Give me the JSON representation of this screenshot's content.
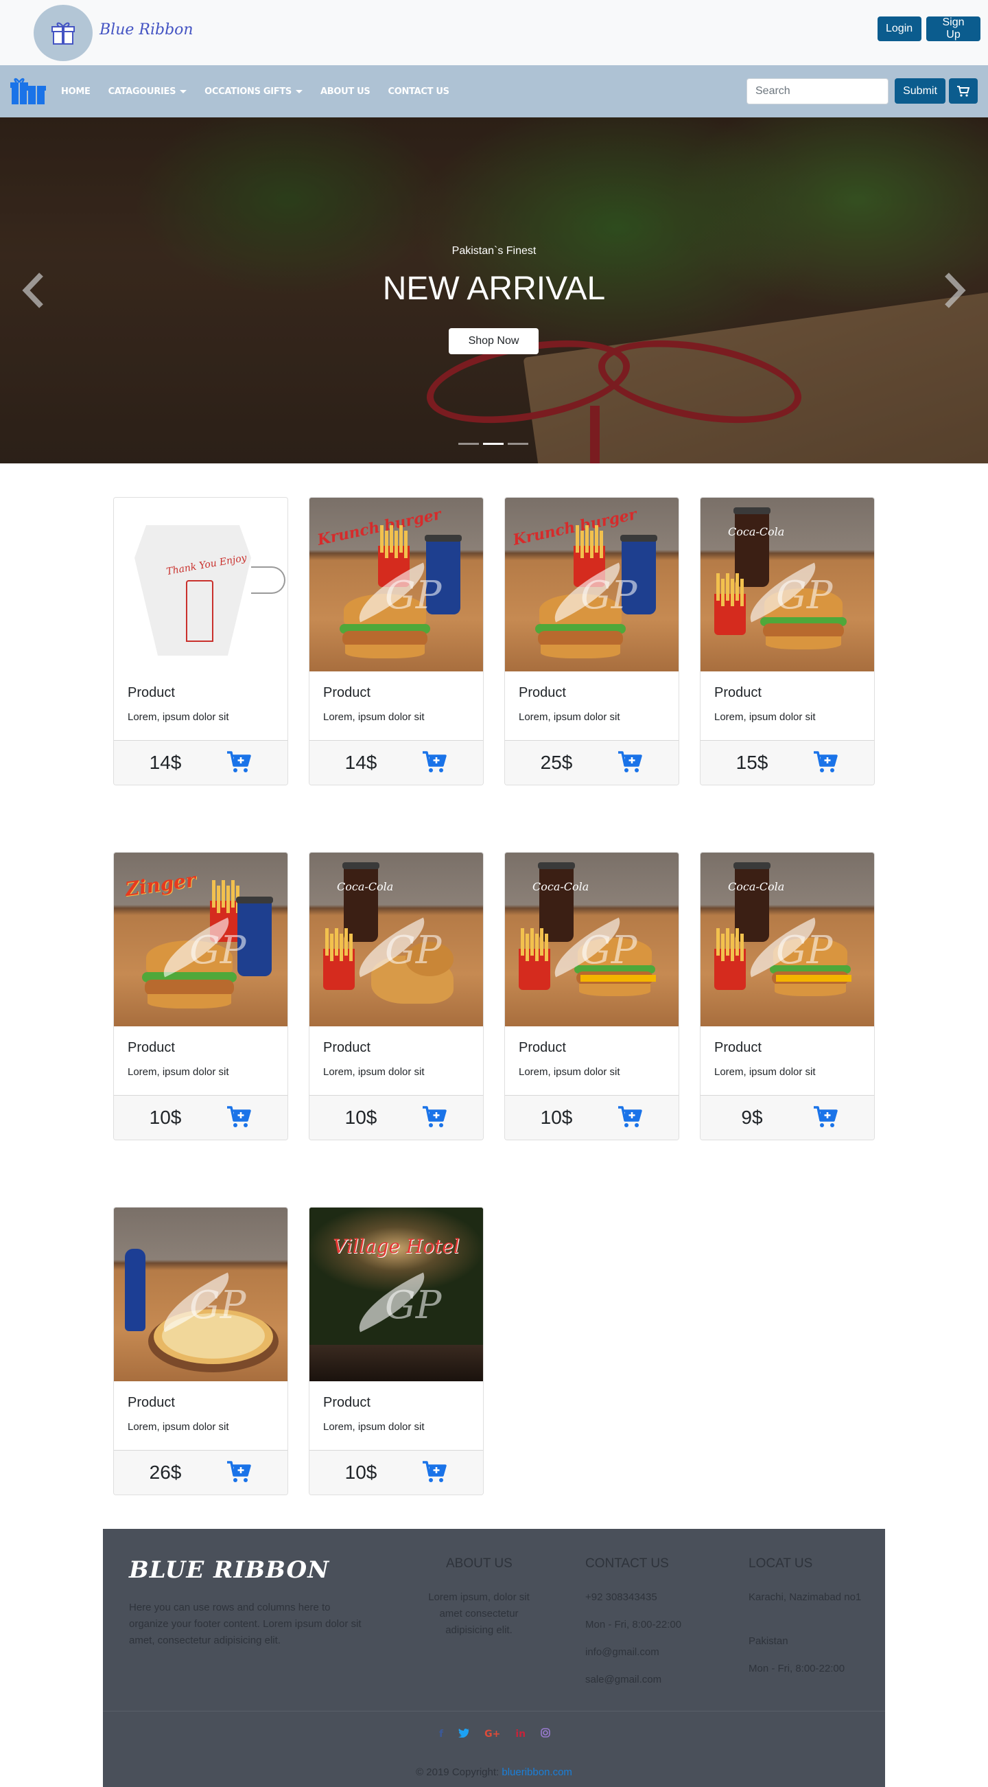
{
  "header": {
    "brand": "Blue Ribbon",
    "login_label": "Login",
    "signup_label": "Sign Up"
  },
  "nav": {
    "links": [
      {
        "label": "HOME"
      },
      {
        "label": "CATAGOURIES"
      },
      {
        "label": "OCCATIONS GIFTS"
      },
      {
        "label": "ABOUT US"
      },
      {
        "label": "CONTACT US"
      }
    ],
    "search_placeholder": "Search",
    "submit_label": "Submit",
    "cart_icon": "cart-icon"
  },
  "carousel": {
    "subtitle": "Pakistan`s Finest",
    "title": "NEW ARRIVAL",
    "button_label": "Shop Now",
    "slides": 3,
    "active_slide": 2
  },
  "products": [
    {
      "title": "Product",
      "text": "Lorem, ipsum dolor sit",
      "price": "14$",
      "image": "takeout-box"
    },
    {
      "title": "Product",
      "text": "Lorem, ipsum dolor sit",
      "price": "14$",
      "image": "krunch-burger"
    },
    {
      "title": "Product",
      "text": "Lorem, ipsum dolor sit",
      "price": "25$",
      "image": "krunch-burger"
    },
    {
      "title": "Product",
      "text": "Lorem, ipsum dolor sit",
      "price": "15$",
      "image": "big-mac-meal"
    },
    {
      "title": "Product",
      "text": "Lorem, ipsum dolor sit",
      "price": "10$",
      "image": "zinger-burger"
    },
    {
      "title": "Product",
      "text": "Lorem, ipsum dolor sit",
      "price": "10$",
      "image": "nuggets-meal"
    },
    {
      "title": "Product",
      "text": "Lorem, ipsum dolor sit",
      "price": "10$",
      "image": "cheeseburger-meal"
    },
    {
      "title": "Product",
      "text": "Lorem, ipsum dolor sit",
      "price": "9$",
      "image": "cheeseburger-meal"
    },
    {
      "title": "Product",
      "text": "Lorem, ipsum dolor sit",
      "price": "26$",
      "image": "pizza"
    },
    {
      "title": "Product",
      "text": "Lorem, ipsum dolor sit",
      "price": "10$",
      "image": "village-hotel"
    }
  ],
  "product_labels": {
    "krunch": "Krunch burger",
    "zinger": "Zinger",
    "coke": "Coca-Cola",
    "village": "Village Hotel",
    "watermark": "GP",
    "box_text": "Thank You Enjoy"
  },
  "footer": {
    "brand": "BLUE RIBBON",
    "description": "Here you can use rows and columns here to organize your footer content. Lorem ipsum dolor sit amet, consectetur adipisicing elit.",
    "about_title": "ABOUT US",
    "about_text": "Lorem ipsum, dolor sit amet consectetur adipisicing elit.",
    "contact_title": "CONTACT US",
    "contact_phone": "+92 308343435",
    "contact_hours": "Mon - Fri, 8:00-22:00",
    "contact_email1": "info@gmail.com",
    "contact_email2": "sale@gmail.com",
    "locat_title": "LOCAT US",
    "locat_line1": "Karachi, Nazimabad no1",
    "locat_line2": "Pakistan",
    "locat_hours": "Mon - Fri, 8:00-22:00",
    "socials": [
      "facebook-icon",
      "twitter-icon",
      "google-plus-icon",
      "linkedin-icon",
      "instagram-icon"
    ],
    "copyright_prefix": "© 2019 Copyright:",
    "copyright_link": "blueribbon.com"
  },
  "colors": {
    "accent": "#0b5c8e",
    "navbar": "#aec2d4",
    "cart_blue": "#1a73e8",
    "footer": "#4a505a"
  }
}
